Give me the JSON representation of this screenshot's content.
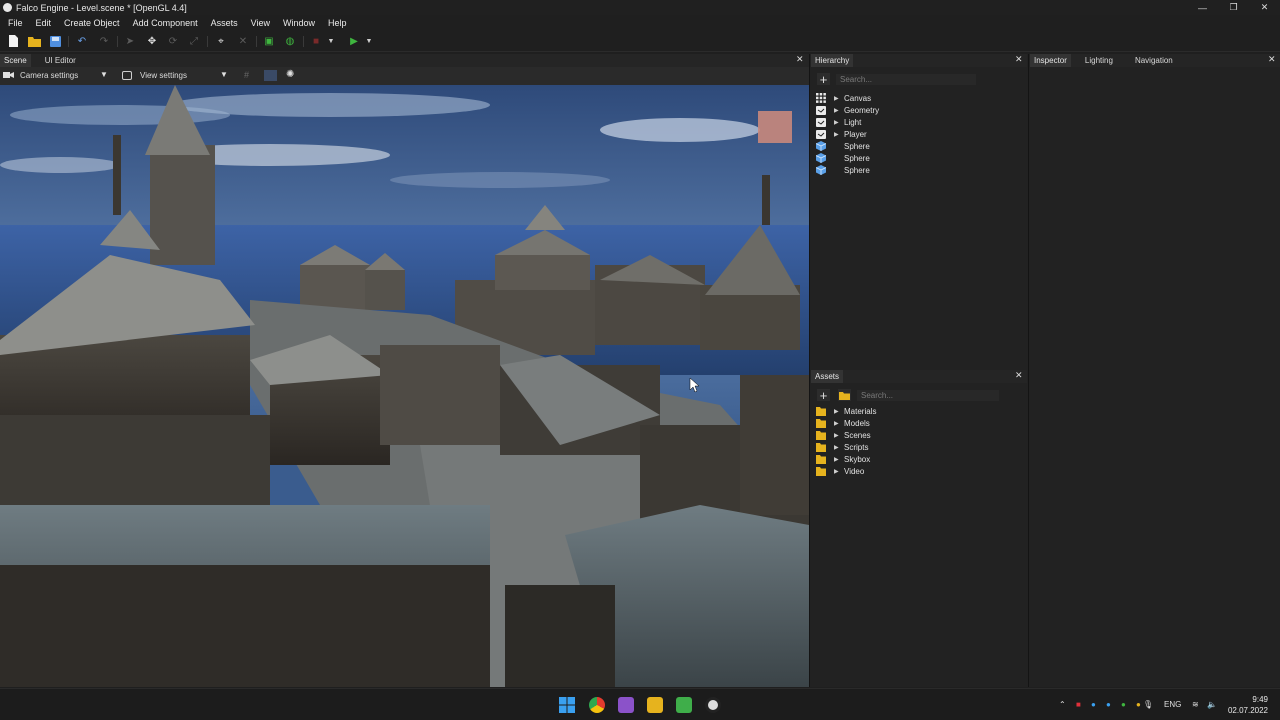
{
  "window": {
    "title": "Falco Engine - Level.scene * [OpenGL 4.4]",
    "minimize": "—",
    "maximize": "❐",
    "close": "✕"
  },
  "menu": [
    "File",
    "Edit",
    "Create Object",
    "Add Component",
    "Assets",
    "View",
    "Window",
    "Help"
  ],
  "scene_panel": {
    "tabs": [
      "Scene",
      "UI Editor"
    ],
    "camera_settings": "Camera settings",
    "view_settings": "View settings"
  },
  "hierarchy": {
    "title": "Hierarchy",
    "search_placeholder": "Search...",
    "items": [
      {
        "label": "Canvas",
        "icon": "canvas-grid-icon",
        "expandable": true
      },
      {
        "label": "Geometry",
        "icon": "object-icon",
        "expandable": true
      },
      {
        "label": "Light",
        "icon": "object-icon",
        "expandable": true
      },
      {
        "label": "Player",
        "icon": "object-icon",
        "expandable": true
      },
      {
        "label": "Sphere",
        "icon": "cube-icon",
        "expandable": false
      },
      {
        "label": "Sphere",
        "icon": "cube-icon",
        "expandable": false
      },
      {
        "label": "Sphere",
        "icon": "cube-icon",
        "expandable": false
      }
    ]
  },
  "inspector_tabs": [
    "Inspector",
    "Lighting",
    "Navigation"
  ],
  "assets": {
    "title": "Assets",
    "search_placeholder": "Search...",
    "folders": [
      "Materials",
      "Models",
      "Scenes",
      "Scripts",
      "Skybox",
      "Video"
    ]
  },
  "taskbar": {
    "language": "ENG",
    "time": "9:49",
    "date": "02.07.2022"
  },
  "colors": {
    "accent_green": "#3fb63f",
    "folder_yellow": "#e6b31e",
    "cube_blue": "#5aa0e8"
  }
}
